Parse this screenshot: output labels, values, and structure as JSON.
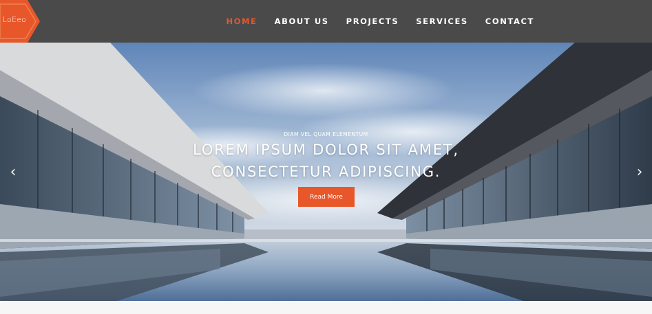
{
  "brand": {
    "logo_text": "LoEeo",
    "accent_color": "#e8572a",
    "header_bg": "#4a4a4a"
  },
  "nav": {
    "items": [
      {
        "label": "HOME",
        "active": true
      },
      {
        "label": "ABOUT US",
        "active": false
      },
      {
        "label": "PROJECTS",
        "active": false
      },
      {
        "label": "SERVICES",
        "active": false
      },
      {
        "label": "CONTACT",
        "active": false
      }
    ]
  },
  "hero": {
    "eyebrow": "DIAM VEL QUAM ELEMENTUM",
    "headline_line1": "LOREM IPSUM DOLOR SIT AMET,",
    "headline_line2": "CONSECTETUR ADIPISCING.",
    "cta_label": "Read More",
    "prev_icon": "chevron-left-icon",
    "next_icon": "chevron-right-icon",
    "prev_glyph": "‹",
    "next_glyph": "›"
  }
}
